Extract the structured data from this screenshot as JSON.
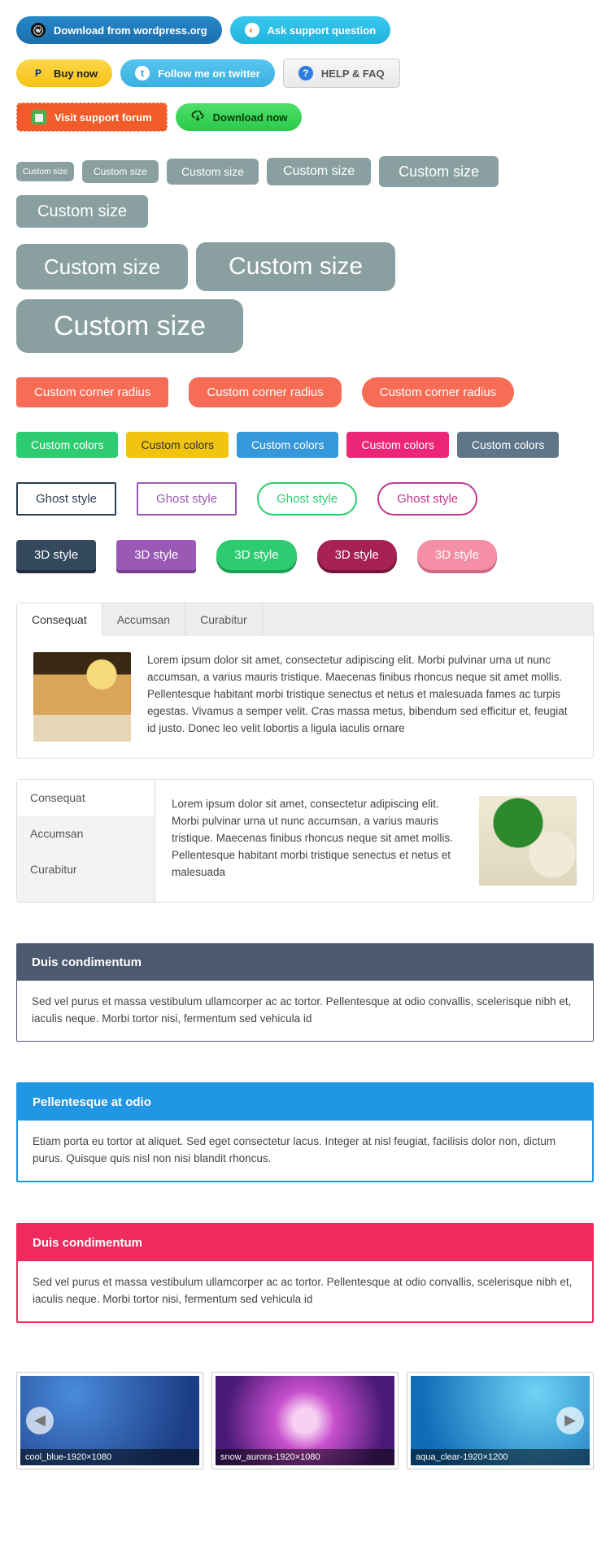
{
  "top_buttons": {
    "download_wp": "Download from wordpress.org",
    "ask_support": "Ask support question",
    "buy_now": "Buy now",
    "follow_tw": "Follow me on twitter",
    "help_faq": "HELP & FAQ",
    "visit_forum": "Visit support forum",
    "download_now": "Download now"
  },
  "custom_size_label": "Custom size",
  "corner_radius_label": "Custom corner radius",
  "custom_colors_label": "Custom colors",
  "ghost_label": "Ghost style",
  "three_d_label": "3D style",
  "tabs": {
    "items": [
      "Consequat",
      "Accumsan",
      "Curabitur"
    ],
    "body": "Lorem ipsum dolor sit amet, consectetur adipiscing elit. Morbi pulvinar urna ut nunc accumsan, a varius mauris tristique. Maecenas finibus rhoncus neque sit amet mollis. Pellentesque habitant morbi tristique senectus et netus et malesuada fames ac turpis egestas. Vivamus a semper velit. Cras massa metus, bibendum sed efficitur et, feugiat id justo. Donec leo velit lobortis a ligula iaculis ornare"
  },
  "vtabs": {
    "items": [
      "Consequat",
      "Accumsan",
      "Curabitur"
    ],
    "body": "Lorem ipsum dolor sit amet, consectetur adipiscing elit. Morbi pulvinar urna ut nunc accumsan, a varius mauris tristique. Maecenas finibus rhoncus neque sit amet mollis. Pellentesque habitant morbi tristique senectus et netus et malesuada"
  },
  "panels": {
    "p1": {
      "title": "Duis condimentum",
      "body": "Sed vel purus et massa vestibulum ullamcorper ac ac tortor. Pellentesque at odio convallis, scelerisque nibh et, iaculis neque. Morbi tortor nisi, fermentum sed vehicula id"
    },
    "p2": {
      "title": "Pellentesque at odio",
      "body": "Etiam porta eu tortor at aliquet. Sed eget consectetur lacus. Integer at nisl feugiat, facilisis dolor non, dictum purus. Quisque quis nisl non nisi blandit rhoncus."
    },
    "p3": {
      "title": "Duis condimentum",
      "body": "Sed vel purus et massa vestibulum ullamcorper ac ac tortor. Pellentesque at odio convallis, scelerisque nibh et, iaculis neque. Morbi tortor nisi, fermentum sed vehicula id"
    }
  },
  "carousel": {
    "c1": "cool_blue-1920×1080",
    "c2": "snow_aurora-1920×1080",
    "c3": "aqua_clear-1920×1200"
  }
}
